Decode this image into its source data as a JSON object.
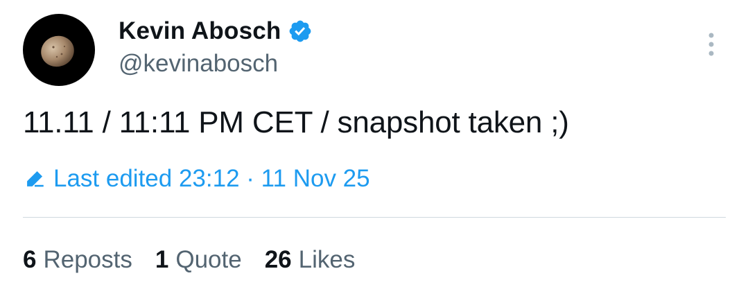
{
  "author": {
    "display_name": "Kevin Abosch",
    "handle": "@kevinabosch",
    "verified_icon": "verified-badge-icon",
    "avatar_icon": "potato-avatar"
  },
  "menu": {
    "icon": "more-vertical-icon"
  },
  "tweet": {
    "text": "11.11 / 11:11 PM CET / snapshot taken ;)",
    "edited_label": "Last edited 23:12 · 11 Nov 25",
    "edited_icon": "pencil-edit-icon"
  },
  "stats": {
    "reposts_count": "6",
    "reposts_label": "Reposts",
    "quote_count": "1",
    "quote_label": "Quote",
    "likes_count": "26",
    "likes_label": "Likes"
  },
  "colors": {
    "accent": "#1d9bf0",
    "text_primary": "#0f1419",
    "text_secondary": "#536471",
    "divider": "#cfd9de"
  }
}
